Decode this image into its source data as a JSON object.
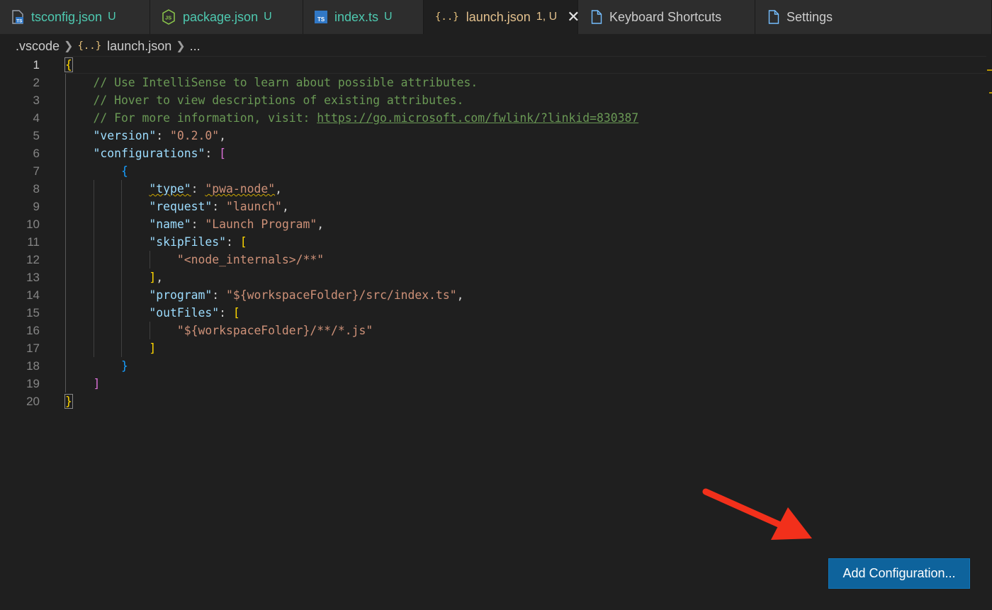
{
  "tabs": [
    {
      "label": "tsconfig.json",
      "badge": "U",
      "icon": "ts-file-icon",
      "color": "#4ec9b0"
    },
    {
      "label": "package.json",
      "badge": "U",
      "icon": "nodejs-icon",
      "color": "#4ec9b0"
    },
    {
      "label": "index.ts",
      "badge": "U",
      "icon": "typescript-icon",
      "color": "#4ec9b0"
    },
    {
      "label": "launch.json",
      "badge": "1, U",
      "icon": "json-braces-icon",
      "color": "#e2c08d",
      "active": true
    },
    {
      "label": "Keyboard Shortcuts",
      "icon": "file-icon",
      "color": "#cccccc"
    },
    {
      "label": "Settings",
      "icon": "file-icon",
      "color": "#cccccc"
    }
  ],
  "tab_icon_text": {
    "braces": "{..}",
    "ts": "TS",
    "js": "JS"
  },
  "breadcrumb": {
    "folder": ".vscode",
    "file_icon_text": "{..}",
    "file": "launch.json",
    "more": "..."
  },
  "editor": {
    "current_line": 1,
    "lines": [
      {
        "n": "1",
        "tokens": [
          {
            "t": "{",
            "c": "c-b1"
          }
        ]
      },
      {
        "n": "2",
        "tokens": [
          {
            "t": "    // Use IntelliSense to learn about possible attributes.",
            "c": "c-com"
          }
        ]
      },
      {
        "n": "3",
        "tokens": [
          {
            "t": "    // Hover to view descriptions of existing attributes.",
            "c": "c-com"
          }
        ]
      },
      {
        "n": "4",
        "tokens": [
          {
            "t": "    // For more information, visit: ",
            "c": "c-com"
          },
          {
            "t": "https://go.microsoft.com/fwlink/?linkid=830387",
            "c": "c-link"
          }
        ]
      },
      {
        "n": "5",
        "tokens": [
          {
            "t": "    ",
            "c": "c-pun"
          },
          {
            "t": "\"version\"",
            "c": "c-key"
          },
          {
            "t": ": ",
            "c": "c-pun"
          },
          {
            "t": "\"0.2.0\"",
            "c": "c-str"
          },
          {
            "t": ",",
            "c": "c-pun"
          }
        ]
      },
      {
        "n": "6",
        "tokens": [
          {
            "t": "    ",
            "c": "c-pun"
          },
          {
            "t": "\"configurations\"",
            "c": "c-key"
          },
          {
            "t": ": ",
            "c": "c-pun"
          },
          {
            "t": "[",
            "c": "c-b2"
          }
        ]
      },
      {
        "n": "7",
        "tokens": [
          {
            "t": "        ",
            "c": "c-pun"
          },
          {
            "t": "{",
            "c": "c-b3"
          }
        ]
      },
      {
        "n": "8",
        "tokens": [
          {
            "t": "            ",
            "c": "c-pun"
          },
          {
            "t": "\"type\"",
            "c": "c-key squig"
          },
          {
            "t": ": ",
            "c": "c-pun"
          },
          {
            "t": "\"pwa-node\"",
            "c": "c-str squig"
          },
          {
            "t": ",",
            "c": "c-pun"
          }
        ]
      },
      {
        "n": "9",
        "tokens": [
          {
            "t": "            ",
            "c": "c-pun"
          },
          {
            "t": "\"request\"",
            "c": "c-key"
          },
          {
            "t": ": ",
            "c": "c-pun"
          },
          {
            "t": "\"launch\"",
            "c": "c-str"
          },
          {
            "t": ",",
            "c": "c-pun"
          }
        ]
      },
      {
        "n": "10",
        "tokens": [
          {
            "t": "            ",
            "c": "c-pun"
          },
          {
            "t": "\"name\"",
            "c": "c-key"
          },
          {
            "t": ": ",
            "c": "c-pun"
          },
          {
            "t": "\"Launch Program\"",
            "c": "c-str"
          },
          {
            "t": ",",
            "c": "c-pun"
          }
        ]
      },
      {
        "n": "11",
        "tokens": [
          {
            "t": "            ",
            "c": "c-pun"
          },
          {
            "t": "\"skipFiles\"",
            "c": "c-key"
          },
          {
            "t": ": ",
            "c": "c-pun"
          },
          {
            "t": "[",
            "c": "c-b1"
          }
        ]
      },
      {
        "n": "12",
        "tokens": [
          {
            "t": "                ",
            "c": "c-pun"
          },
          {
            "t": "\"<node_internals>/**\"",
            "c": "c-str"
          }
        ]
      },
      {
        "n": "13",
        "tokens": [
          {
            "t": "            ",
            "c": "c-pun"
          },
          {
            "t": "]",
            "c": "c-b1"
          },
          {
            "t": ",",
            "c": "c-pun"
          }
        ]
      },
      {
        "n": "14",
        "tokens": [
          {
            "t": "            ",
            "c": "c-pun"
          },
          {
            "t": "\"program\"",
            "c": "c-key"
          },
          {
            "t": ": ",
            "c": "c-pun"
          },
          {
            "t": "\"${workspaceFolder}/src/index.ts\"",
            "c": "c-str"
          },
          {
            "t": ",",
            "c": "c-pun"
          }
        ]
      },
      {
        "n": "15",
        "tokens": [
          {
            "t": "            ",
            "c": "c-pun"
          },
          {
            "t": "\"outFiles\"",
            "c": "c-key"
          },
          {
            "t": ": ",
            "c": "c-pun"
          },
          {
            "t": "[",
            "c": "c-b1"
          }
        ]
      },
      {
        "n": "16",
        "tokens": [
          {
            "t": "                ",
            "c": "c-pun"
          },
          {
            "t": "\"${workspaceFolder}/**/*.js\"",
            "c": "c-str"
          }
        ]
      },
      {
        "n": "17",
        "tokens": [
          {
            "t": "            ",
            "c": "c-pun"
          },
          {
            "t": "]",
            "c": "c-b1"
          }
        ]
      },
      {
        "n": "18",
        "tokens": [
          {
            "t": "        ",
            "c": "c-pun"
          },
          {
            "t": "}",
            "c": "c-b3"
          }
        ]
      },
      {
        "n": "19",
        "tokens": [
          {
            "t": "    ",
            "c": "c-pun"
          },
          {
            "t": "]",
            "c": "c-b2"
          }
        ]
      },
      {
        "n": "20",
        "tokens": [
          {
            "t": "}",
            "c": "c-b1"
          }
        ]
      }
    ]
  },
  "add_configuration_button": {
    "label": "Add Configuration..."
  },
  "colors": {
    "editor_bg": "#1f1f1f",
    "button_bg": "#0e639c",
    "arrow": "#f2301b"
  }
}
